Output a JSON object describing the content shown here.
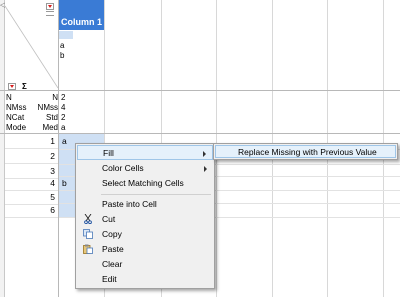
{
  "table": {
    "column_header": "Column 1",
    "histogram_labels": [
      "a",
      "b"
    ],
    "sigma": "Σ"
  },
  "stats": {
    "left_labels": [
      "N",
      "NMss",
      "NCat",
      "Mode"
    ],
    "right_labels": [
      "N",
      "NMss",
      "Std",
      "Med"
    ],
    "values": [
      "2",
      "4",
      "2",
      "a"
    ]
  },
  "rows": [
    {
      "num": "1",
      "value": "a",
      "selected": true
    },
    {
      "num": "2",
      "value": "",
      "selected": true
    },
    {
      "num": "3",
      "value": "",
      "selected": true
    },
    {
      "num": "4",
      "value": "b",
      "selected": true
    },
    {
      "num": "5",
      "value": "",
      "selected": true
    },
    {
      "num": "6",
      "value": "",
      "selected": true
    }
  ],
  "context_menu": {
    "items": [
      {
        "label": "Fill",
        "has_submenu": true,
        "highlighted": true,
        "icon": ""
      },
      {
        "label": "Color Cells",
        "has_submenu": true,
        "highlighted": false,
        "icon": ""
      },
      {
        "label": "Select Matching Cells",
        "has_submenu": false,
        "highlighted": false,
        "icon": ""
      },
      {
        "label": "Paste into Cell",
        "has_submenu": false,
        "highlighted": false,
        "icon": ""
      },
      {
        "label": "Cut",
        "has_submenu": false,
        "highlighted": false,
        "icon": "scissors-icon"
      },
      {
        "label": "Copy",
        "has_submenu": false,
        "highlighted": false,
        "icon": "copy-icon"
      },
      {
        "label": "Paste",
        "has_submenu": false,
        "highlighted": false,
        "icon": "paste-icon"
      },
      {
        "label": "Clear",
        "has_submenu": false,
        "highlighted": false,
        "icon": ""
      },
      {
        "label": "Edit",
        "has_submenu": false,
        "highlighted": false,
        "icon": ""
      }
    ]
  },
  "submenu": {
    "items": [
      {
        "label": "Replace Missing with Previous Value",
        "highlighted": true
      }
    ]
  },
  "colors": {
    "header_blue": "#3a7bd5",
    "selection": "#cfe0f4",
    "menu_bg": "#f0f0f0",
    "menu_highlight": "#e5f1fb",
    "menu_highlight_border": "#9fc6e8",
    "dropdown_red": "#d61e1e"
  }
}
